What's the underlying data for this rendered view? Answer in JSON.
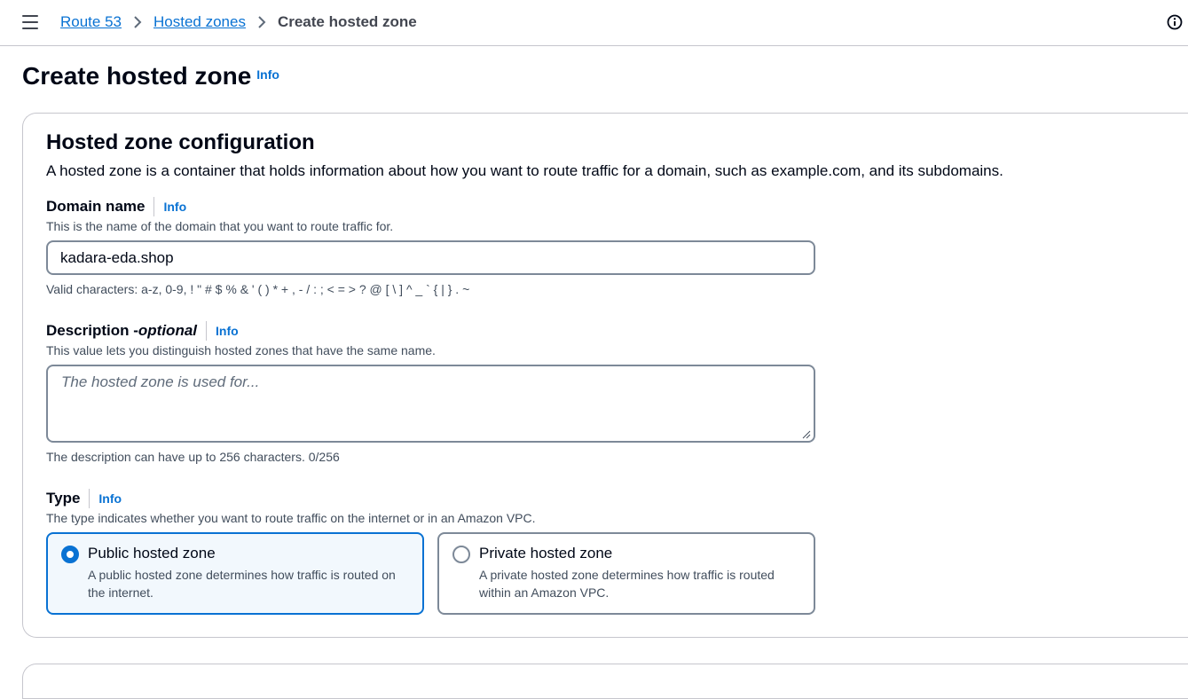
{
  "breadcrumb": {
    "items": [
      "Route 53",
      "Hosted zones"
    ],
    "current": "Create hosted zone"
  },
  "page": {
    "title": "Create hosted zone",
    "info": "Info"
  },
  "config": {
    "title": "Hosted zone configuration",
    "description": "A hosted zone is a container that holds information about how you want to route traffic for a domain, such as example.com, and its subdomains.",
    "domain": {
      "label": "Domain name",
      "info": "Info",
      "description": "This is the name of the domain that you want to route traffic for.",
      "value": "kadara-eda.shop",
      "hint": "Valid characters: a-z, 0-9, ! \" # $ % & ' ( ) * + , - / : ; < = > ? @ [ \\ ] ^ _ ` { | } . ~"
    },
    "description_field": {
      "label": "Description - ",
      "label_optional": "optional",
      "info": "Info",
      "description": "This value lets you distinguish hosted zones that have the same name.",
      "placeholder": "The hosted zone is used for...",
      "value": "",
      "hint": "The description can have up to 256 characters. 0/256"
    },
    "type": {
      "label": "Type",
      "info": "Info",
      "description": "The type indicates whether you want to route traffic on the internet or in an Amazon VPC.",
      "options": [
        {
          "title": "Public hosted zone",
          "description": "A public hosted zone determines how traffic is routed on the internet.",
          "selected": true
        },
        {
          "title": "Private hosted zone",
          "description": "A private hosted zone determines how traffic is routed within an Amazon VPC.",
          "selected": false
        }
      ]
    }
  },
  "colors": {
    "link": "#0972d3",
    "selected_bg": "#f2f8fd",
    "border": "#7d8998"
  },
  "icons": {
    "menu": "hamburger-icon",
    "help": "info-circle-icon",
    "separator": "chevron-right-icon"
  }
}
